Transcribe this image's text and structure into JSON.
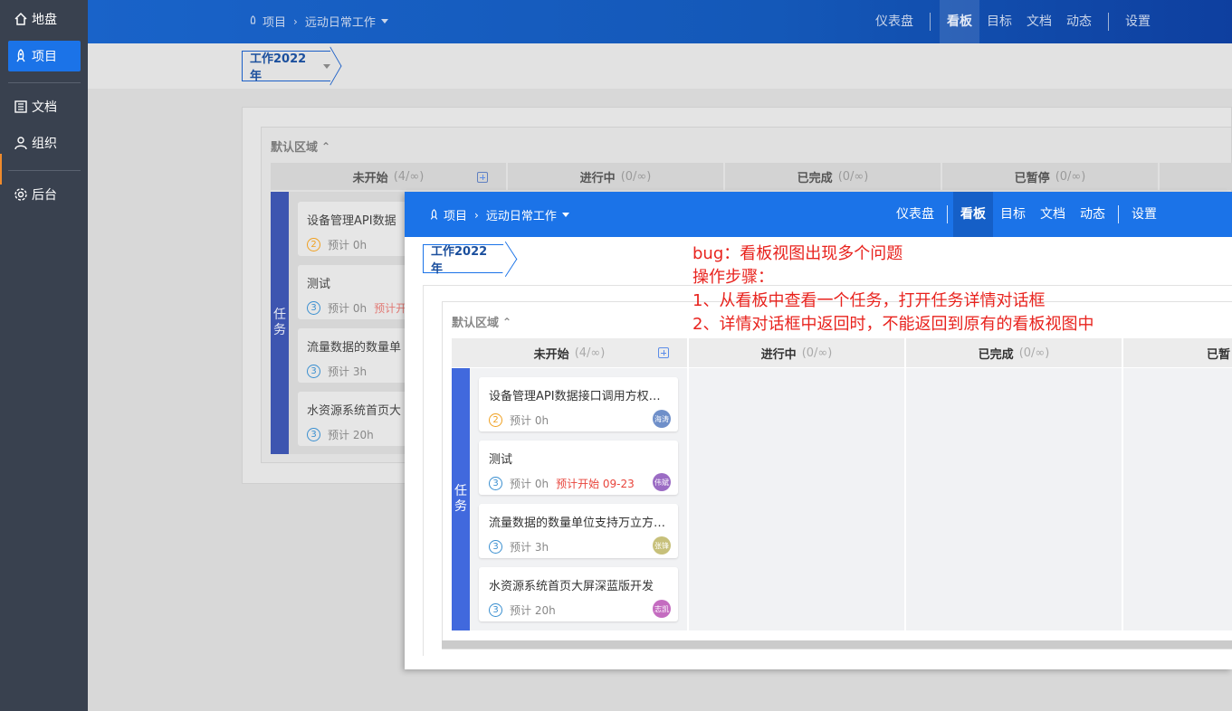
{
  "sidebar": {
    "items": [
      {
        "label": "地盘",
        "icon": "home-icon"
      },
      {
        "label": "项目",
        "icon": "rocket-icon"
      },
      {
        "label": "文档",
        "icon": "document-list-icon"
      },
      {
        "label": "组织",
        "icon": "user-icon"
      },
      {
        "label": "后台",
        "icon": "gear-icon"
      }
    ]
  },
  "header": {
    "breadcrumb": {
      "root": "项目",
      "current": "远动日常工作"
    },
    "nav": [
      "仪表盘",
      "看板",
      "目标",
      "文档",
      "动态",
      "设置"
    ],
    "active_nav": "看板"
  },
  "board": {
    "tag": "工作2022年",
    "area_title": "默认区域",
    "columns": [
      {
        "name": "未开始",
        "count": "(4/∞)"
      },
      {
        "name": "进行中",
        "count": "(0/∞)"
      },
      {
        "name": "已完成",
        "count": "(0/∞)"
      },
      {
        "name": "已暂停",
        "count": "(0/∞)"
      }
    ],
    "lane": "任务",
    "cards": [
      {
        "title": "设备管理API数据接口调用方权…",
        "priority": "2",
        "estimate": "预计 0h",
        "start": "",
        "assignee": "海涛",
        "avatar_color": "#6f8fc9"
      },
      {
        "title": "测试",
        "priority": "3",
        "estimate": "预计 0h",
        "start": "预计开始 09-23",
        "assignee": "伟斌",
        "avatar_color": "#9b6cc4"
      },
      {
        "title": "流量数据的数量单位支持万立方…",
        "priority": "3",
        "estimate": "预计 3h",
        "start": "",
        "assignee": "张锋",
        "avatar_color": "#c7c07a"
      },
      {
        "title": "水资源系统首页大屏深蓝版开发",
        "priority": "3",
        "estimate": "预计 20h",
        "start": "",
        "assignee": "志凯",
        "avatar_color": "#c46cc0"
      }
    ],
    "bg_cards": [
      {
        "title": "设备管理API数据",
        "priority": "2",
        "estimate": "预计 0h",
        "start": ""
      },
      {
        "title": "测试",
        "priority": "3",
        "estimate": "预计 0h",
        "start": "预计开"
      },
      {
        "title": "流量数据的数量单",
        "priority": "3",
        "estimate": "预计 3h",
        "start": ""
      },
      {
        "title": "水资源系统首页大",
        "priority": "3",
        "estimate": "预计 20h",
        "start": ""
      }
    ],
    "truncated_column": "已暂"
  },
  "note": {
    "lines": [
      "bug：看板视图出现多个问题",
      "操作步骤：",
      "1、从看板中查看一个任务，打开任务详情对话框",
      "2、详情对话框中返回时，不能返回到原有的看板视图中"
    ]
  },
  "colors": {
    "primary": "#1b73e8",
    "sidebar_bg": "#39414f",
    "lane": "#4169dd",
    "annotation": "#e8231e",
    "priority2": "#f0a020",
    "priority3": "#3a8fd0"
  }
}
